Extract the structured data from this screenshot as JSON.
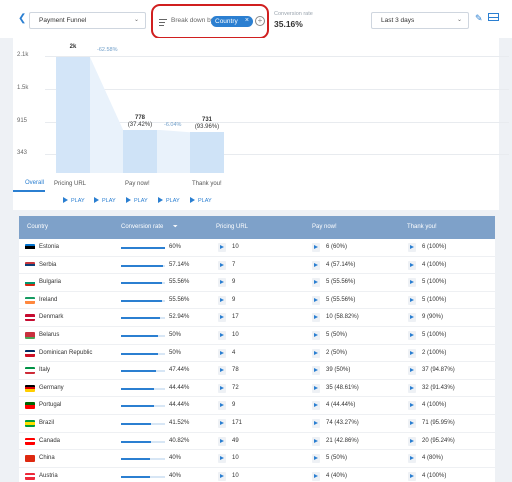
{
  "toolbar": {
    "back_icon": "chevron-left-icon",
    "funnel_select": "Payment Funnel",
    "breakdown_label": "Break down by",
    "breakdown_chip": "Country",
    "chip_close": "×",
    "add_breakdown": "+",
    "conversion_label": "Conversion rate",
    "conversion_value": "35.16%",
    "date_select": "Last 3 days",
    "edit_icon": "pencil-icon",
    "table_icon": "table-view-icon",
    "accent_color": "#2b7fd1",
    "highlight_color": "#d01f1f"
  },
  "chart_data": {
    "type": "bar",
    "categories": [
      "Pricing URL",
      "Pay now!",
      "Thank you!"
    ],
    "values": [
      2080,
      778,
      731
    ],
    "ytick_labels": [
      "2.1k",
      "1.5k",
      "915",
      "343"
    ],
    "yticks": [
      2100,
      1500,
      915,
      343
    ],
    "ylim": [
      0,
      2100
    ],
    "value_labels": [
      "2k",
      "778",
      "731"
    ],
    "pct_labels": [
      "",
      "(37.42%)",
      "(93.96%)"
    ],
    "drop_labels": [
      "-62.58%",
      "-6.04%"
    ]
  },
  "tabs": {
    "overall": "Overall"
  },
  "play": {
    "label": "PLAY",
    "count": 5
  },
  "table": {
    "headers": [
      "Country",
      "Conversion rate",
      "Pricing URL",
      "Pay now!",
      "Thank you!"
    ],
    "sort_icon": "sort-icon",
    "rows": [
      {
        "country": "Estonia",
        "rate_text": "60%",
        "rate": 0.6,
        "pricing": "10",
        "pay": "6 (60%)",
        "thanks": "6 (100%)",
        "flag": [
          "#0072CE",
          "#000000",
          "#FFFFFF"
        ]
      },
      {
        "country": "Serbia",
        "rate_text": "57.14%",
        "rate": 0.5714,
        "pricing": "7",
        "pay": "4 (57.14%)",
        "thanks": "4 (100%)",
        "flag": [
          "#C6363C",
          "#0C4076",
          "#FFFFFF"
        ]
      },
      {
        "country": "Bulgaria",
        "rate_text": "55.56%",
        "rate": 0.5556,
        "pricing": "9",
        "pay": "5 (55.56%)",
        "thanks": "5 (100%)",
        "flag": [
          "#FFFFFF",
          "#00966E",
          "#D62612"
        ]
      },
      {
        "country": "Ireland",
        "rate_text": "55.56%",
        "rate": 0.5556,
        "pricing": "9",
        "pay": "5 (55.56%)",
        "thanks": "5 (100%)",
        "flag": [
          "#169B62",
          "#FFFFFF",
          "#FF883E"
        ]
      },
      {
        "country": "Denmark",
        "rate_text": "52.94%",
        "rate": 0.5294,
        "pricing": "17",
        "pay": "10 (58.82%)",
        "thanks": "9 (90%)",
        "flag": [
          "#C60C30",
          "#FFFFFF",
          "#C60C30"
        ]
      },
      {
        "country": "Belarus",
        "rate_text": "50%",
        "rate": 0.5,
        "pricing": "10",
        "pay": "5 (50%)",
        "thanks": "5 (100%)",
        "flag": [
          "#C8313E",
          "#C8313E",
          "#4AA657"
        ]
      },
      {
        "country": "Dominican Republic",
        "rate_text": "50%",
        "rate": 0.5,
        "pricing": "4",
        "pay": "2 (50%)",
        "thanks": "2 (100%)",
        "flag": [
          "#002D62",
          "#FFFFFF",
          "#CE1126"
        ]
      },
      {
        "country": "Italy",
        "rate_text": "47.44%",
        "rate": 0.4744,
        "pricing": "78",
        "pay": "39 (50%)",
        "thanks": "37 (94.87%)",
        "flag": [
          "#009246",
          "#FFFFFF",
          "#CE2B37"
        ]
      },
      {
        "country": "Germany",
        "rate_text": "44.44%",
        "rate": 0.4444,
        "pricing": "72",
        "pay": "35 (48.61%)",
        "thanks": "32 (91.43%)",
        "flag": [
          "#000000",
          "#DD0000",
          "#FFCE00"
        ]
      },
      {
        "country": "Portugal",
        "rate_text": "44.44%",
        "rate": 0.4444,
        "pricing": "9",
        "pay": "4 (44.44%)",
        "thanks": "4 (100%)",
        "flag": [
          "#006600",
          "#FF0000",
          "#FF0000"
        ]
      },
      {
        "country": "Brazil",
        "rate_text": "41.52%",
        "rate": 0.4152,
        "pricing": "171",
        "pay": "74 (43.27%)",
        "thanks": "71 (95.95%)",
        "flag": [
          "#009C3B",
          "#FFDF00",
          "#009C3B"
        ]
      },
      {
        "country": "Canada",
        "rate_text": "40.82%",
        "rate": 0.4082,
        "pricing": "49",
        "pay": "21 (42.86%)",
        "thanks": "20 (95.24%)",
        "flag": [
          "#FF0000",
          "#FFFFFF",
          "#FF0000"
        ]
      },
      {
        "country": "China",
        "rate_text": "40%",
        "rate": 0.4,
        "pricing": "10",
        "pay": "5 (50%)",
        "thanks": "4 (80%)",
        "flag": [
          "#DE2910",
          "#DE2910",
          "#DE2910"
        ]
      },
      {
        "country": "Austria",
        "rate_text": "40%",
        "rate": 0.4,
        "pricing": "10",
        "pay": "4 (40%)",
        "thanks": "4 (100%)",
        "flag": [
          "#ED2939",
          "#FFFFFF",
          "#ED2939"
        ]
      }
    ]
  }
}
